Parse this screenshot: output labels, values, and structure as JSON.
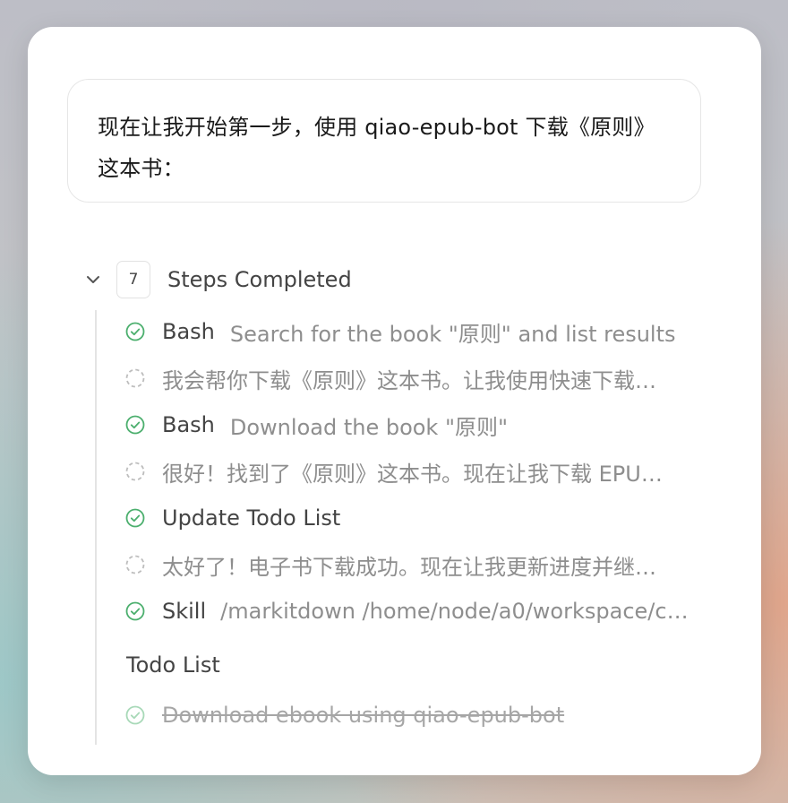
{
  "message": {
    "text": "现在让我开始第一步，使用 qiao-epub-bot 下载《原则》这本书："
  },
  "steps": {
    "count": "7",
    "title": "Steps Completed",
    "items": [
      {
        "status": "completed",
        "tool": "Bash",
        "desc": "Search for the book \"原则\" and list results"
      },
      {
        "status": "thinking",
        "tool": "",
        "desc": "我会帮你下载《原则》这本书。让我使用快速下载…"
      },
      {
        "status": "completed",
        "tool": "Bash",
        "desc": "Download the book \"原则\""
      },
      {
        "status": "thinking",
        "tool": "",
        "desc": "很好！找到了《原则》这本书。现在让我下载 EPU…"
      },
      {
        "status": "completed",
        "tool": "Update Todo List",
        "desc": ""
      },
      {
        "status": "thinking",
        "tool": "",
        "desc": "太好了！电子书下载成功。现在让我更新进度并继…"
      },
      {
        "status": "completed",
        "tool": "Skill",
        "desc": "/markitdown /home/node/a0/workspace/c…"
      }
    ]
  },
  "todo": {
    "title": "Todo List",
    "items": [
      {
        "text": "Download ebook using qiao-epub-bot",
        "done": true
      }
    ]
  },
  "colors": {
    "success": "#4caf6e",
    "success_faded": "#a8d9b8",
    "pending": "#bdbdbd"
  },
  "icons": {
    "completed": "check-circle-icon",
    "thinking": "dashed-circle-icon",
    "toggle": "chevron-down-icon"
  }
}
